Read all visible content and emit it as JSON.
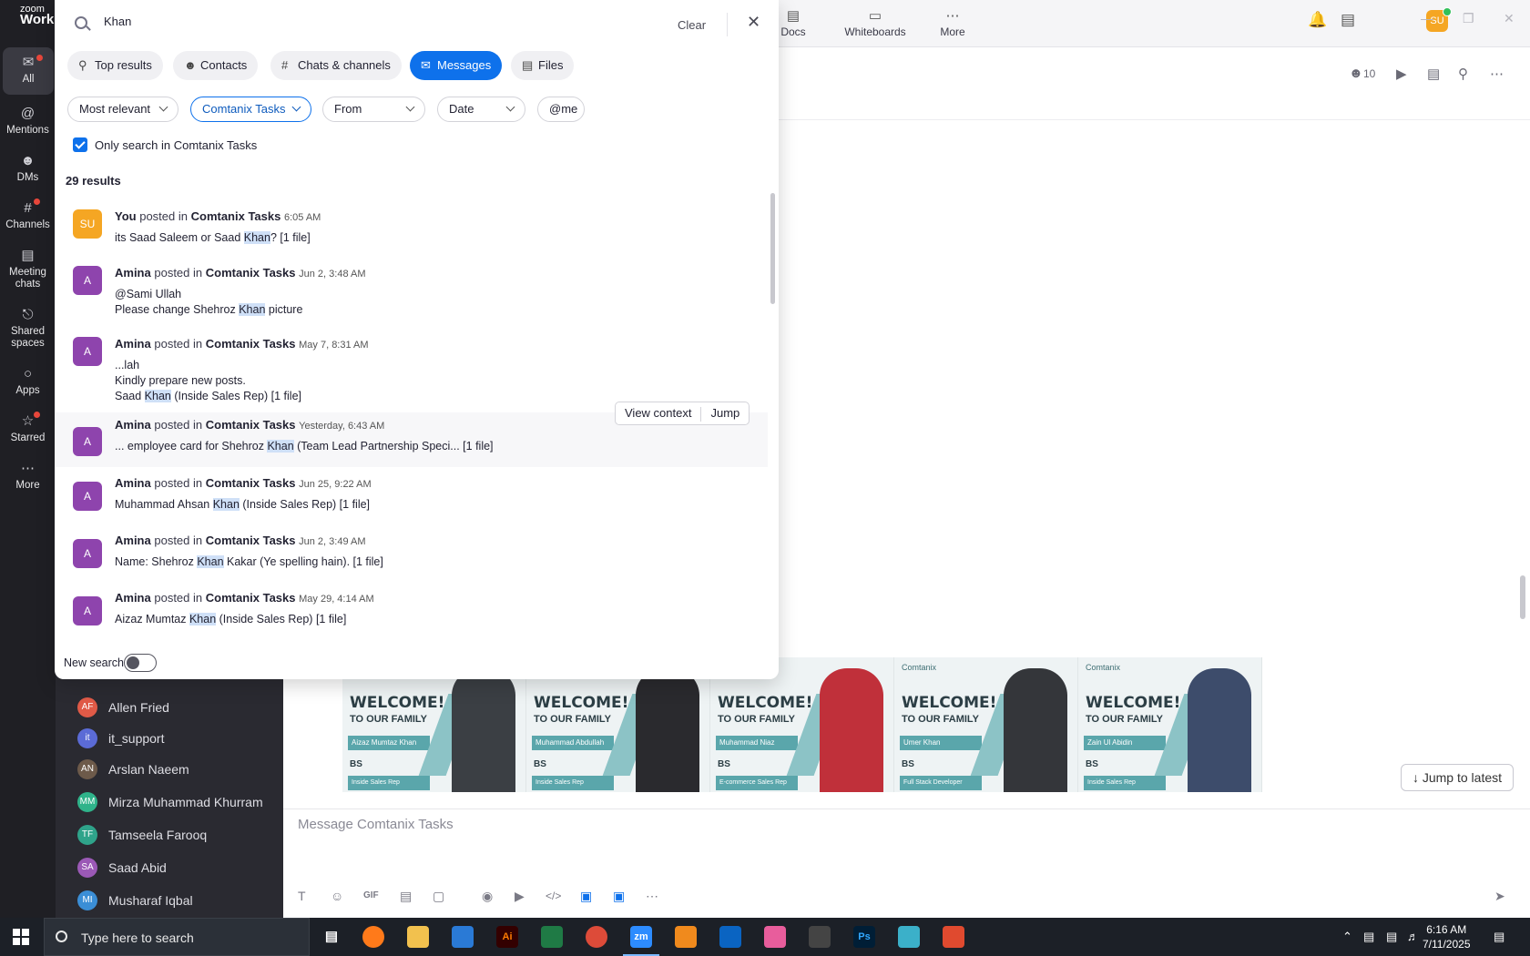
{
  "rail": {
    "logo_top": "zoom",
    "logo_bottom": "Work",
    "items": [
      {
        "label": "All",
        "icon": "chat-bubble-icon"
      },
      {
        "label": "Mentions",
        "icon": "at-icon"
      },
      {
        "label": "DMs",
        "icon": "people-icon"
      },
      {
        "label": "Channels",
        "icon": "hash-icon"
      },
      {
        "label": "Meeting chats",
        "icon": "calendar-icon"
      },
      {
        "label": "Shared spaces",
        "icon": "share-icon"
      },
      {
        "label": "Apps",
        "icon": "apps-icon"
      },
      {
        "label": "Starred",
        "icon": "star-icon"
      },
      {
        "label": "More",
        "icon": "more-icon"
      }
    ]
  },
  "topbar": {
    "tabs": [
      {
        "label": "Docs",
        "icon": "docs-icon"
      },
      {
        "label": "Whiteboards",
        "icon": "whiteboard-icon"
      },
      {
        "label": "More",
        "icon": "more-icon"
      }
    ],
    "avatar": "SU"
  },
  "channel_list": [
    {
      "initials": "AF",
      "name": "Allen Fried",
      "color": "#e05a47"
    },
    {
      "initials": "it",
      "name": "it_support",
      "color": "#5b6bd6"
    },
    {
      "initials": "AN",
      "name": "Arslan Naeem",
      "color": "#6d5a4a"
    },
    {
      "initials": "MM",
      "name": "Mirza Muhammad Khurram",
      "color": "#2fb38a"
    },
    {
      "initials": "TF",
      "name": "Tamseela Farooq",
      "color": "#2fa38a"
    },
    {
      "initials": "SA",
      "name": "Saad Abid",
      "color": "#9b59b6"
    },
    {
      "initials": "MI",
      "name": "Musharaf Iqbal",
      "color": "#3b8ed6"
    }
  ],
  "chat": {
    "member_count": "10",
    "composer_placeholder": "Message Comtanix Tasks",
    "jump_latest": "Jump to latest",
    "welcome_cards": [
      {
        "title": "WELCOME!",
        "subtitle": "TO OUR FAMILY",
        "name": "Aizaz Mumtaz Khan",
        "degree": "BS",
        "role": "Inside Sales Rep",
        "brand": ""
      },
      {
        "title": "WELCOME!",
        "subtitle": "TO OUR FAMILY",
        "name": "Muhammad Abdullah",
        "degree": "BS",
        "role": "Inside Sales Rep",
        "brand": ""
      },
      {
        "title": "WELCOME!",
        "subtitle": "TO OUR FAMILY",
        "name": "Muhammad Niaz",
        "degree": "BS",
        "role": "E-commerce Sales Rep",
        "brand": ""
      },
      {
        "title": "WELCOME!",
        "subtitle": "TO OUR FAMILY",
        "name": "Umer Khan",
        "degree": "BS",
        "role": "Full Stack Developer",
        "brand": "Comtanix"
      },
      {
        "title": "WELCOME!",
        "subtitle": "TO OUR FAMILY",
        "name": "Zain Ul Abidin",
        "degree": "BS",
        "role": "Inside Sales Rep",
        "brand": "Comtanix"
      }
    ]
  },
  "search": {
    "query": "Khan",
    "clear_label": "Clear",
    "tabs": [
      {
        "label": "Top results",
        "icon": "search-icon"
      },
      {
        "label": "Contacts",
        "icon": "person-icon"
      },
      {
        "label": "Chats & channels",
        "icon": "hash-icon"
      },
      {
        "label": "Messages",
        "icon": "message-icon"
      },
      {
        "label": "Files",
        "icon": "file-icon"
      }
    ],
    "filters": [
      "Most relevant",
      "Comtanix Tasks",
      "From",
      "Date",
      "@me"
    ],
    "only_search_label": "Only search in Comtanix Tasks",
    "result_count": "29 results",
    "view_context": "View context",
    "jump": "Jump",
    "new_search_label": "New search",
    "results": [
      {
        "initials": "SU",
        "author": "You",
        "verb": "posted in",
        "channel": "Comtanix Tasks",
        "time": "6:05 AM",
        "lines": [
          [
            "its Saad Saleem or Saad ",
            "Khan",
            "? [1 file]"
          ]
        ]
      },
      {
        "initials": "A",
        "author": "Amina",
        "verb": "posted in",
        "channel": "Comtanix Tasks",
        "time": "Jun 2, 3:48 AM",
        "lines": [
          [
            "@Sami Ullah",
            "",
            ""
          ],
          [
            "Please change Shehroz ",
            "Khan",
            " picture"
          ]
        ]
      },
      {
        "initials": "A",
        "author": "Amina",
        "verb": "posted in",
        "channel": "Comtanix Tasks",
        "time": "May 7, 8:31 AM",
        "lines": [
          [
            "...lah",
            "",
            ""
          ],
          [
            "Kindly prepare new posts.",
            "",
            ""
          ],
          [
            "Saad ",
            "Khan",
            " (Inside Sales Rep) [1 file]"
          ]
        ]
      },
      {
        "initials": "A",
        "author": "Amina",
        "verb": "posted in",
        "channel": "Comtanix Tasks",
        "time": "Yesterday, 6:43 AM",
        "lines": [
          [
            "... employee card for Shehroz ",
            "Khan",
            " (Team Lead Partnership Speci... [1 file]"
          ]
        ]
      },
      {
        "initials": "A",
        "author": "Amina",
        "verb": "posted in",
        "channel": "Comtanix Tasks",
        "time": "Jun 25, 9:22 AM",
        "lines": [
          [
            "Muhammad Ahsan ",
            "Khan",
            " (Inside Sales Rep) [1 file]"
          ]
        ]
      },
      {
        "initials": "A",
        "author": "Amina",
        "verb": "posted in",
        "channel": "Comtanix Tasks",
        "time": "Jun 2, 3:49 AM",
        "lines": [
          [
            "Name: Shehroz ",
            "Khan",
            " Kakar (Ye spelling hain). [1 file]"
          ]
        ]
      },
      {
        "initials": "A",
        "author": "Amina",
        "verb": "posted in",
        "channel": "Comtanix Tasks",
        "time": "May 29, 4:14 AM",
        "lines": [
          [
            "Aizaz Mumtaz ",
            "Khan",
            " (Inside Sales Rep) [1 file]"
          ]
        ]
      }
    ]
  },
  "taskbar": {
    "search_placeholder": "Type here to search",
    "time": "6:16 AM",
    "date": "7/11/2025",
    "apps": [
      "Ai",
      "zm",
      "Ps"
    ]
  }
}
